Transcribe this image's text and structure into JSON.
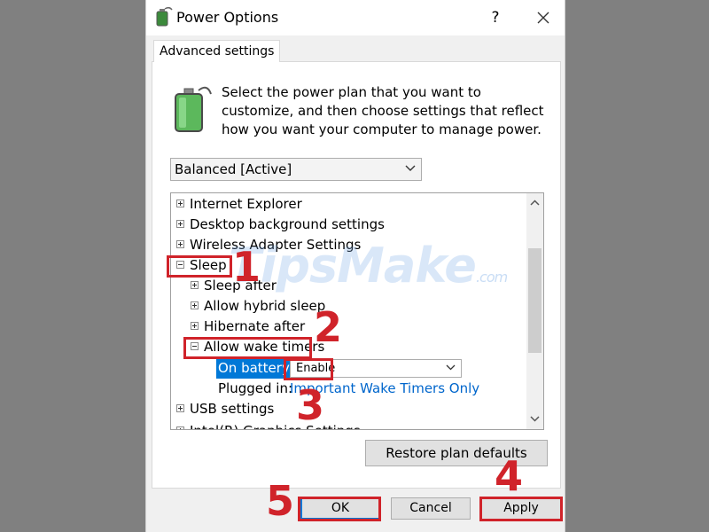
{
  "window": {
    "title": "Power Options",
    "help_glyph": "?",
    "icon": "power-options-icon"
  },
  "tab": {
    "label": "Advanced settings"
  },
  "intro": {
    "icon": "battery-plug-icon",
    "text": "Select the power plan that you want to customize, and then choose settings that reflect how you want your computer to manage power."
  },
  "plan_select": {
    "value": "Balanced [Active]"
  },
  "tree": {
    "rows": [
      {
        "label": "Internet Explorer",
        "state": "collapsed"
      },
      {
        "label": "Desktop background settings",
        "state": "collapsed"
      },
      {
        "label": "Wireless Adapter Settings",
        "state": "collapsed"
      },
      {
        "label": "Sleep",
        "state": "expanded"
      },
      {
        "label": "Sleep after",
        "state": "collapsed"
      },
      {
        "label": "Allow hybrid sleep",
        "state": "collapsed"
      },
      {
        "label": "Hibernate after",
        "state": "collapsed"
      },
      {
        "label": "Allow wake timers",
        "state": "expanded"
      },
      {
        "label": "USB settings",
        "state": "collapsed"
      },
      {
        "label": "Intel(R) Graphics Settings",
        "state": "collapsed"
      }
    ],
    "on_battery": {
      "label": "On battery:",
      "value": "Enable"
    },
    "plugged_in": {
      "label": "Plugged in:",
      "value": "Important Wake Timers Only"
    }
  },
  "buttons": {
    "restore": "Restore plan defaults",
    "ok": "OK",
    "cancel": "Cancel",
    "apply": "Apply"
  },
  "annotations": {
    "steps": [
      "1",
      "2",
      "3",
      "4",
      "5"
    ],
    "color": "#d0232a"
  },
  "watermark": {
    "brand": "TipsMake",
    "suffix": ".com"
  },
  "colors": {
    "selection": "#0078d7",
    "link": "#0066cc"
  }
}
